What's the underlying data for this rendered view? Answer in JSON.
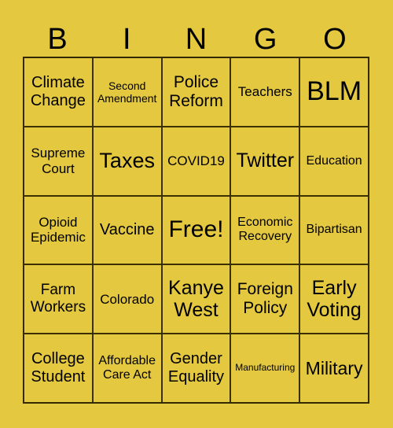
{
  "header": [
    "B",
    "I",
    "N",
    "G",
    "O"
  ],
  "colors": {
    "background": "#E3C840",
    "grid_line": "#3a3000"
  },
  "cells": [
    {
      "text": "Climate Change",
      "size": 20
    },
    {
      "text": "Second Amendment",
      "size": 14
    },
    {
      "text": "Police Reform",
      "size": 21
    },
    {
      "text": "Teachers",
      "size": 17
    },
    {
      "text": "BLM",
      "size": 34
    },
    {
      "text": "Supreme Court",
      "size": 17
    },
    {
      "text": "Taxes",
      "size": 27
    },
    {
      "text": "COVID19",
      "size": 17
    },
    {
      "text": "Twitter",
      "size": 25
    },
    {
      "text": "Education",
      "size": 16
    },
    {
      "text": "Opioid Epidemic",
      "size": 17
    },
    {
      "text": "Vaccine",
      "size": 20
    },
    {
      "text": "Free!",
      "size": 30
    },
    {
      "text": "Economic Recovery",
      "size": 16
    },
    {
      "text": "Bipartisan",
      "size": 16
    },
    {
      "text": "Farm Workers",
      "size": 19
    },
    {
      "text": "Colorado",
      "size": 17
    },
    {
      "text": "Kanye West",
      "size": 25
    },
    {
      "text": "Foreign Policy",
      "size": 21
    },
    {
      "text": "Early Voting",
      "size": 25
    },
    {
      "text": "College Student",
      "size": 20
    },
    {
      "text": "Affordable Care Act",
      "size": 16
    },
    {
      "text": "Gender Equality",
      "size": 20
    },
    {
      "text": "Manufacturing",
      "size": 12
    },
    {
      "text": "Military",
      "size": 23
    }
  ]
}
